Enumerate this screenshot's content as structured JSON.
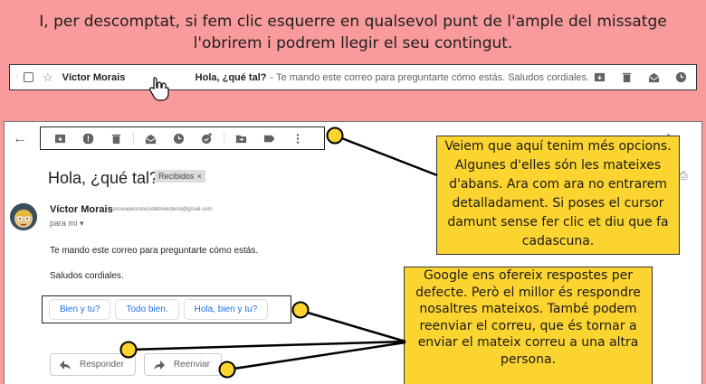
{
  "caption": "I, per descomptat, si fem clic esquerre en qualsevol punt de l'ample del missatge l'obrirem i podrem llegir el seu contingut.",
  "inbox_row": {
    "sender": "Víctor Morais",
    "subject": "Hola, ¿qué tal?",
    "snippet": "- Te mando este correo para preguntarte cómo estás. Saludos cordiales.",
    "icons": [
      "archive-icon",
      "trash-icon",
      "mark-read-icon",
      "snooze-icon"
    ]
  },
  "message": {
    "back_glyph": "←",
    "toolbar_icons": [
      "archive-icon",
      "report-spam-icon",
      "delete-icon",
      "mark-unread-icon",
      "snooze-icon",
      "add-task-icon",
      "move-to-icon",
      "labels-icon",
      "more-icon"
    ],
    "subject": "Hola, ¿qué tal?",
    "label": "Recibidos",
    "label_close": "×",
    "from_name": "Víctor Morais",
    "from_email": "correoelecronicodelministerio@gmail.com",
    "to_me": "para mí ▾",
    "body_line1": "Te mando este correo para preguntarte cómo estás.",
    "body_line2": "Saludos cordiales.",
    "smart_replies": [
      "Bien y tu?",
      "Todo bien.",
      "Hola, bien y tu?"
    ],
    "reply_label": "Responder",
    "forward_label": "Reenviar"
  },
  "notes": {
    "note1": "Veiem que aquí tenim més opcions. Algunes d'elles són les mateixes d'abans. Ara com ara no entrarem detalladament. Si poses el cursor damunt sense fer clic et diu que fa cadascuna.",
    "note2": "Google ens ofereix respostes per defecte. Però el millor és respondre nosaltres mateixos. També podem reenviar el correu, que és tornar a enviar el mateix correu a una altra persona."
  },
  "colors": {
    "background": "#f99a9c",
    "note": "#fcd430",
    "link": "#1a73e8"
  }
}
